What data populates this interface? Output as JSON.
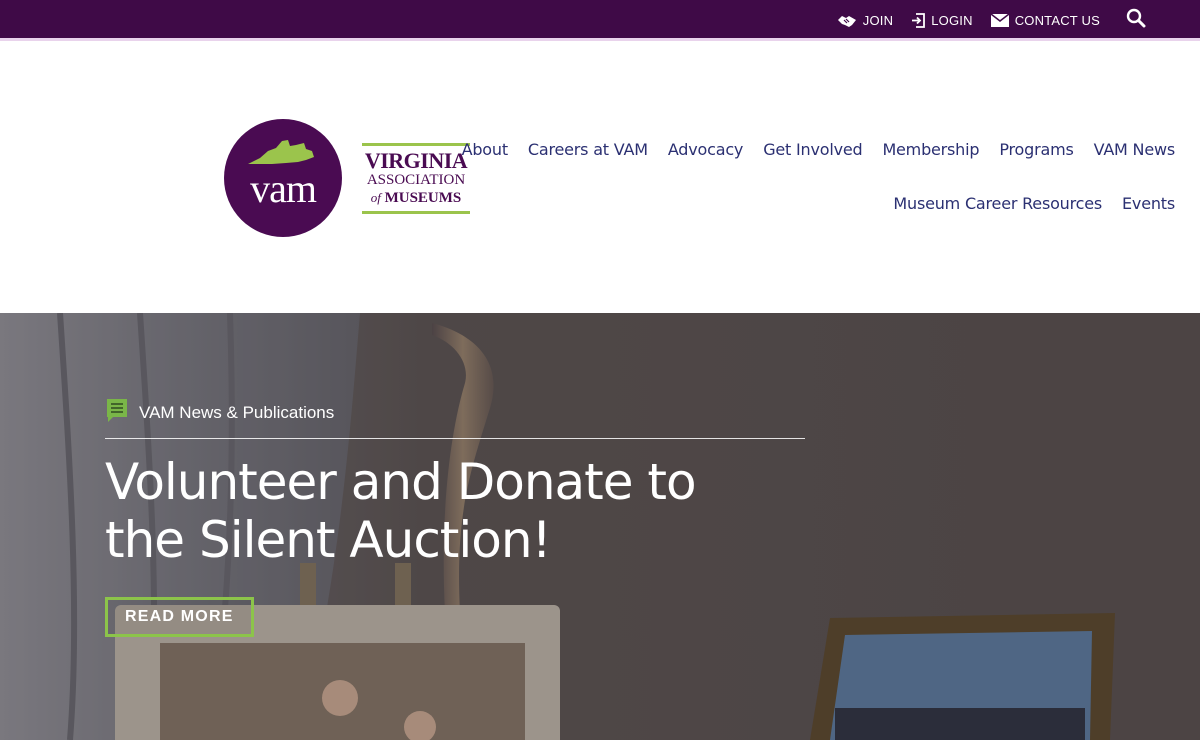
{
  "utility_bar": {
    "join": "JOIN",
    "login": "LOGIN",
    "contact": "CONTACT US"
  },
  "logo": {
    "mark": "vam",
    "line1": "VIRGINIA",
    "line2": "ASSOCIATION",
    "line3_prefix": "of",
    "line3": "MUSEUMS"
  },
  "nav": {
    "row1": [
      "About",
      "Careers at VAM",
      "Advocacy",
      "Get Involved",
      "Membership",
      "Programs",
      "VAM News"
    ],
    "row2": [
      "Museum Career Resources",
      "Events"
    ]
  },
  "hero": {
    "category": "VAM News & Publications",
    "title": "Volunteer and Donate to the Silent Auction!",
    "button": "READ MORE"
  },
  "colors": {
    "topbar": "#3f0a47",
    "brand_purple": "#4a0b52",
    "accent_green": "#8cc44a",
    "nav_text": "#2b3072"
  }
}
